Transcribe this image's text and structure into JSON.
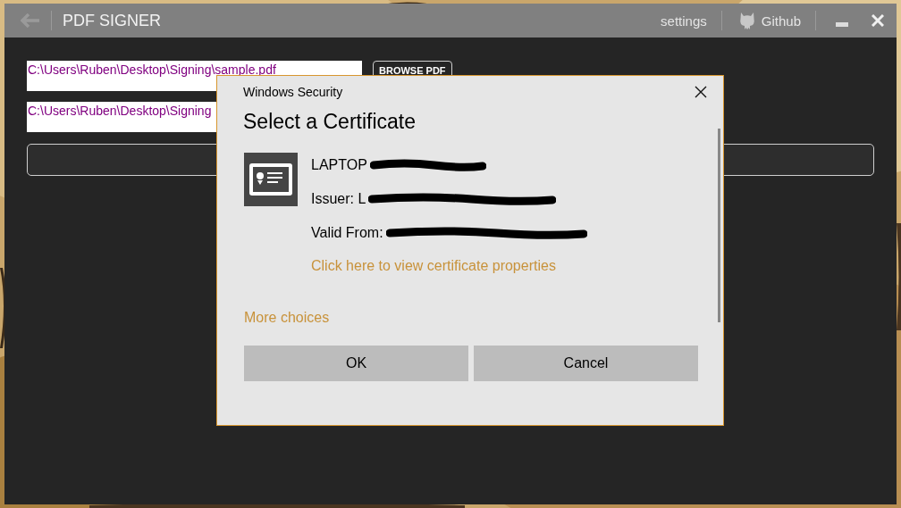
{
  "window": {
    "title": "PDF SIGNER",
    "header_links": [
      "settings",
      "Github"
    ]
  },
  "fields": [
    {
      "value": "C:\\Users\\Ruben\\Desktop\\Signing\\sample.pdf"
    },
    {
      "value": "C:\\Users\\Ruben\\Desktop\\Signing"
    }
  ],
  "browse_button": "BROWSE PDF",
  "dialog": {
    "caption": "Windows Security",
    "heading": "Select a Certificate",
    "certificate": {
      "subject": "LAPTOP",
      "issuer": "Issuer: L",
      "valid_from": "Valid From:",
      "redacted": true
    },
    "properties_link": "Click here to view certificate properties",
    "more_choices": "More choices",
    "buttons": [
      "OK",
      "Cancel"
    ]
  }
}
